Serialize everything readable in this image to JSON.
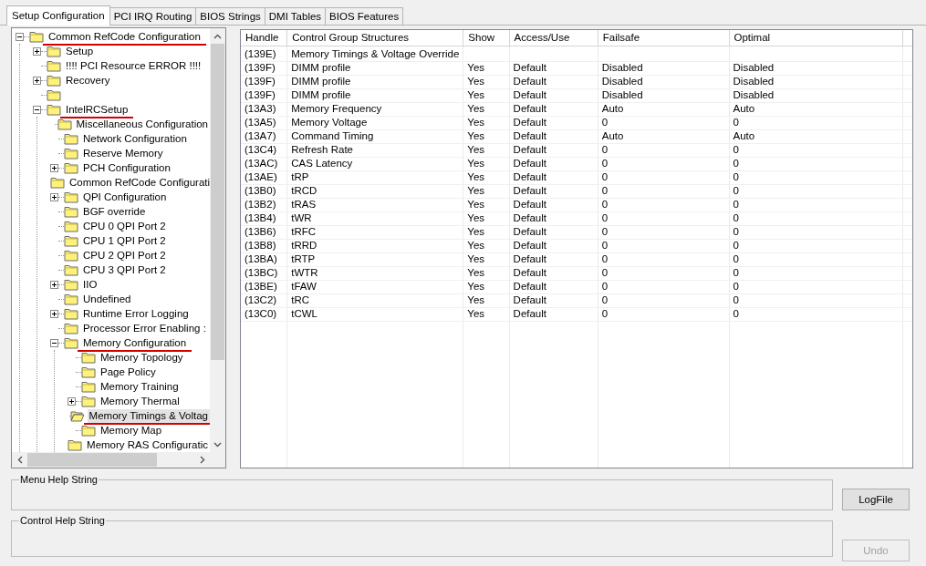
{
  "tabs": [
    {
      "label": "Setup Configuration",
      "selected": true
    },
    {
      "label": "PCI IRQ Routing",
      "selected": false
    },
    {
      "label": "BIOS Strings",
      "selected": false
    },
    {
      "label": "DMI Tables",
      "selected": false
    },
    {
      "label": "BIOS Features",
      "selected": false
    }
  ],
  "tree": [
    {
      "label": "Common RefCode Configuration",
      "expanded": true,
      "underlined": true,
      "selected": false,
      "children": [
        {
          "label": "Setup",
          "expanded": false,
          "underlined": false,
          "selected": false
        },
        {
          "label": "!!!! PCI Resource ERROR !!!!",
          "underlined": false,
          "selected": false
        },
        {
          "label": "Recovery",
          "expanded": false,
          "underlined": false,
          "selected": false
        },
        {
          "selected": false
        },
        {
          "label": "IntelRCSetup",
          "expanded": true,
          "underlined": true,
          "selected": false,
          "children": [
            {
              "label": "Miscellaneous Configuration",
              "underlined": false,
              "selected": false
            },
            {
              "label": "Network Configuration",
              "underlined": false,
              "selected": false
            },
            {
              "label": "Reserve Memory",
              "underlined": false,
              "selected": false
            },
            {
              "label": "PCH Configuration",
              "expanded": false,
              "underlined": false,
              "selected": false
            },
            {
              "label": "Common RefCode Configurati",
              "underlined": false,
              "selected": false
            },
            {
              "label": "QPI Configuration",
              "expanded": false,
              "underlined": false,
              "selected": false
            },
            {
              "label": "BGF override",
              "underlined": false,
              "selected": false
            },
            {
              "label": "CPU 0 QPI Port 2",
              "underlined": false,
              "selected": false
            },
            {
              "label": "CPU 1 QPI Port 2",
              "underlined": false,
              "selected": false
            },
            {
              "label": "CPU 2 QPI Port 2",
              "underlined": false,
              "selected": false
            },
            {
              "label": "CPU 3 QPI Port 2",
              "underlined": false,
              "selected": false
            },
            {
              "label": "IIO",
              "expanded": false,
              "underlined": false,
              "selected": false
            },
            {
              "label": "Undefined",
              "underlined": false,
              "selected": false
            },
            {
              "label": "Runtime Error Logging",
              "expanded": false,
              "underlined": false,
              "selected": false
            },
            {
              "label": "Processor Error Enabling :",
              "underlined": false,
              "selected": false
            },
            {
              "label": "Memory Configuration",
              "expanded": true,
              "underlined": true,
              "selected": false,
              "children": [
                {
                  "label": "Memory Topology",
                  "underlined": false,
                  "selected": false
                },
                {
                  "label": "Page Policy",
                  "underlined": false,
                  "selected": false
                },
                {
                  "label": "Memory Training",
                  "underlined": false,
                  "selected": false
                },
                {
                  "label": "Memory Thermal",
                  "expanded": false,
                  "underlined": false,
                  "selected": false
                },
                {
                  "label": "Memory Timings & Voltag",
                  "underlined": true,
                  "selected": true
                },
                {
                  "label": "Memory Map",
                  "underlined": false,
                  "selected": false
                },
                {
                  "label": "Memory RAS Configuratic",
                  "underlined": false,
                  "selected": false
                }
              ]
            }
          ]
        }
      ]
    }
  ],
  "table": {
    "columns": [
      "Handle",
      "Control Group Structures",
      "Show",
      "Access/Use",
      "Failsafe",
      "Optimal"
    ],
    "rows": [
      [
        "(139E)",
        "Memory Timings & Voltage Override"
      ],
      [
        "(139F)",
        "DIMM profile",
        "Yes",
        "Default",
        "Disabled",
        "Disabled"
      ],
      [
        "(139F)",
        "DIMM profile",
        "Yes",
        "Default",
        "Disabled",
        "Disabled"
      ],
      [
        "(139F)",
        "DIMM profile",
        "Yes",
        "Default",
        "Disabled",
        "Disabled"
      ],
      [
        "(13A3)",
        "Memory Frequency",
        "Yes",
        "Default",
        "Auto",
        "Auto"
      ],
      [
        "(13A5)",
        "Memory Voltage",
        "Yes",
        "Default",
        "0",
        "0"
      ],
      [
        "(13A7)",
        "Command Timing",
        "Yes",
        "Default",
        "Auto",
        "Auto"
      ],
      [
        "(13C4)",
        "Refresh Rate",
        "Yes",
        "Default",
        "0",
        "0"
      ],
      [
        "(13AC)",
        "CAS Latency",
        "Yes",
        "Default",
        "0",
        "0"
      ],
      [
        "(13AE)",
        "tRP",
        "Yes",
        "Default",
        "0",
        "0"
      ],
      [
        "(13B0)",
        "tRCD",
        "Yes",
        "Default",
        "0",
        "0"
      ],
      [
        "(13B2)",
        "tRAS",
        "Yes",
        "Default",
        "0",
        "0"
      ],
      [
        "(13B4)",
        "tWR",
        "Yes",
        "Default",
        "0",
        "0"
      ],
      [
        "(13B6)",
        "tRFC",
        "Yes",
        "Default",
        "0",
        "0"
      ],
      [
        "(13B8)",
        "tRRD",
        "Yes",
        "Default",
        "0",
        "0"
      ],
      [
        "(13BA)",
        "tRTP",
        "Yes",
        "Default",
        "0",
        "0"
      ],
      [
        "(13BC)",
        "tWTR",
        "Yes",
        "Default",
        "0",
        "0"
      ],
      [
        "(13BE)",
        "tFAW",
        "Yes",
        "Default",
        "0",
        "0"
      ],
      [
        "(13C2)",
        "tRC",
        "Yes",
        "Default",
        "0",
        "0"
      ],
      [
        "(13C0)",
        "tCWL",
        "Yes",
        "Default",
        "0",
        "0"
      ]
    ]
  },
  "menu_help": {
    "title": "Menu Help String"
  },
  "control_help": {
    "title": "Control Help String"
  },
  "buttons": [
    {
      "label": "LogFile",
      "disabled": false
    },
    {
      "label": "Undo",
      "disabled": true
    }
  ]
}
